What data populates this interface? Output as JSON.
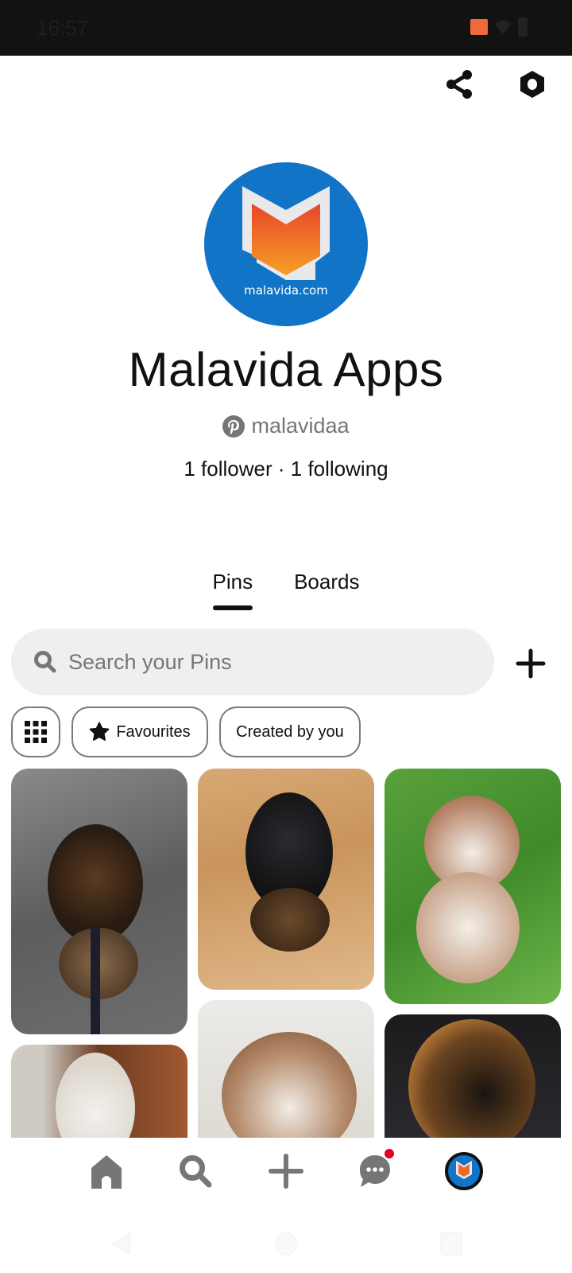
{
  "status_bar": {
    "time": "16:57",
    "icons": [
      "cast-icon",
      "wifi-icon",
      "battery-icon"
    ]
  },
  "header": {
    "actions": [
      {
        "name": "share",
        "icon": "share-icon"
      },
      {
        "name": "settings",
        "icon": "settings-hex-icon"
      }
    ]
  },
  "profile": {
    "avatar_text": "malavida.com",
    "name": "Malavida Apps",
    "handle": "malavidaa",
    "handle_icon": "pinterest-icon",
    "stats": "1 follower · 1 following"
  },
  "tabs": [
    {
      "label": "Pins",
      "active": true
    },
    {
      "label": "Boards",
      "active": false
    }
  ],
  "search": {
    "placeholder": "Search your Pins",
    "value": ""
  },
  "filters": [
    {
      "label": "",
      "icon": "grid-icon"
    },
    {
      "label": "Favourites",
      "icon": "star-icon"
    },
    {
      "label": "Created by you",
      "icon": ""
    }
  ],
  "pins": [
    {
      "subject": "German Shepherd puppy on leash on gravel"
    },
    {
      "subject": "German Shepherd puppy with snow on wooden stairs"
    },
    {
      "subject": "Red husky puppy on grass"
    },
    {
      "subject": "White husky by a chair"
    },
    {
      "subject": "Australian Shepherd in snow"
    },
    {
      "subject": "German Shepherd puppy close-up"
    }
  ],
  "bottom_nav": [
    {
      "name": "home",
      "icon": "home-icon"
    },
    {
      "name": "search",
      "icon": "search-icon"
    },
    {
      "name": "create",
      "icon": "plus-icon"
    },
    {
      "name": "messages",
      "icon": "chat-icon",
      "has_notification": true
    },
    {
      "name": "profile",
      "icon": "avatar"
    }
  ],
  "colors": {
    "accent_blue": "#1274c6",
    "notification_red": "#e60023",
    "text_primary": "#111111",
    "text_secondary": "#767676",
    "search_bg": "#efefef"
  }
}
